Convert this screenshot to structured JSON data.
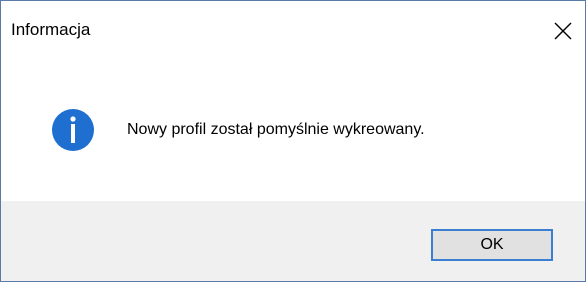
{
  "window": {
    "title": "Informacja",
    "close_icon": "close-icon"
  },
  "message": {
    "icon": "info-icon",
    "text": "Nowy profil został pomyślnie wykreowany."
  },
  "buttons": {
    "ok_label": "OK"
  },
  "colors": {
    "info_icon": "#1e6fd0",
    "button_focus_border": "#3c7fd1",
    "button_bg": "#e1e1e1",
    "footer_bg": "#f0f0f0"
  }
}
